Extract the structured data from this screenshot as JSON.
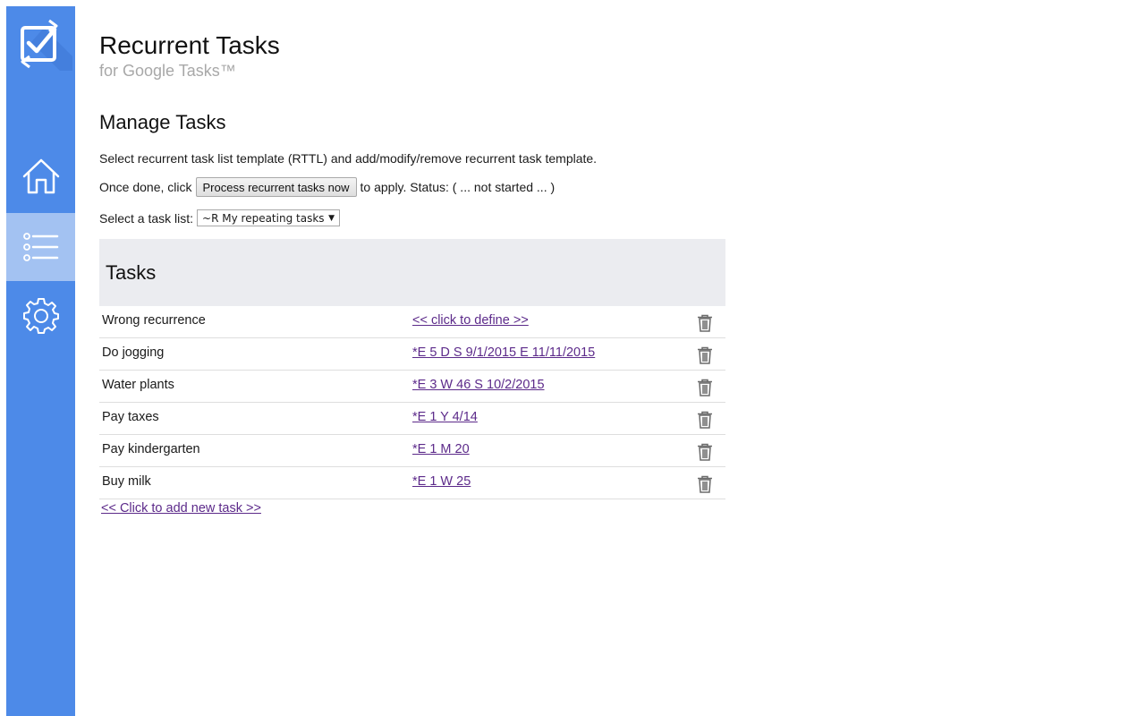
{
  "colors": {
    "sidebar": "#4d8ae8",
    "sidebar_active": "#a3c2f2",
    "link": "#5c2a8a",
    "tasks_header_bg": "#ebecf0",
    "subtitle": "#a8a8a8"
  },
  "sidebar": {
    "logo_icon": "recurrent-check-icon",
    "items": [
      {
        "icon": "home-icon",
        "active": false
      },
      {
        "icon": "list-icon",
        "active": true
      },
      {
        "icon": "gear-icon",
        "active": false
      }
    ]
  },
  "header": {
    "title": "Recurrent Tasks",
    "subtitle": "for Google Tasks™"
  },
  "manage": {
    "title": "Manage Tasks",
    "intro": "Select recurrent task list template (RTTL) and add/modify/remove recurrent task template.",
    "once_done": "Once done, click",
    "process_button": "Process recurrent tasks now",
    "to_apply": "to apply. Status: ( ... not started ... )",
    "select_label": "Select a task list:",
    "selected_list": "~R My repeating tasks"
  },
  "tasks": {
    "title": "Tasks",
    "rows": [
      {
        "name": "Wrong recurrence",
        "rule": "<< click to define >>"
      },
      {
        "name": "Do jogging",
        "rule": "*E 5 D S 9/1/2015 E 11/11/2015"
      },
      {
        "name": "Water plants",
        "rule": "*E 3 W 46 S 10/2/2015"
      },
      {
        "name": "Pay taxes",
        "rule": "*E 1 Y 4/14"
      },
      {
        "name": "Pay kindergarten",
        "rule": "*E 1 M 20"
      },
      {
        "name": "Buy milk",
        "rule": "*E 1 W 25"
      }
    ],
    "add_link": "<< Click to add new task >>"
  }
}
